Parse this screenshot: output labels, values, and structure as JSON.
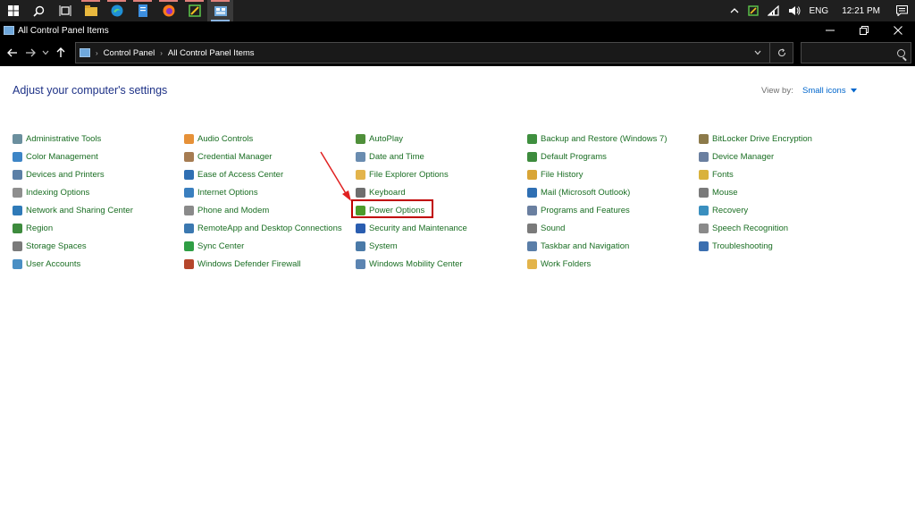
{
  "taskbar": {
    "tray": {
      "language": "ENG",
      "time": "12:21 PM"
    }
  },
  "window": {
    "title": "All Control Panel Items"
  },
  "address": {
    "breadcrumbs": [
      "Control Panel",
      "All Control Panel Items"
    ],
    "search_placeholder": ""
  },
  "page": {
    "heading": "Adjust your computer's settings",
    "view_by_label": "View by:",
    "view_by_value": "Small icons"
  },
  "items": [
    [
      {
        "label": "Administrative Tools",
        "icon": "admin-tools-icon",
        "color": "#6b8f9e"
      },
      {
        "label": "Color Management",
        "icon": "color-management-icon",
        "color": "#3d85c6"
      },
      {
        "label": "Devices and Printers",
        "icon": "printer-icon",
        "color": "#5b7fa6"
      },
      {
        "label": "Indexing Options",
        "icon": "indexing-icon",
        "color": "#8e8e8e"
      },
      {
        "label": "Network and Sharing Center",
        "icon": "network-icon",
        "color": "#2f7ab8"
      },
      {
        "label": "Region",
        "icon": "region-icon",
        "color": "#3d8b3d"
      },
      {
        "label": "Storage Spaces",
        "icon": "storage-icon",
        "color": "#7a7a7a"
      },
      {
        "label": "User Accounts",
        "icon": "user-accounts-icon",
        "color": "#4a8fc4"
      }
    ],
    [
      {
        "label": "Audio Controls",
        "icon": "audio-controls-icon",
        "color": "#e69138"
      },
      {
        "label": "Credential Manager",
        "icon": "credential-icon",
        "color": "#a67c52"
      },
      {
        "label": "Ease of Access Center",
        "icon": "ease-of-access-icon",
        "color": "#2f6fb3"
      },
      {
        "label": "Internet Options",
        "icon": "internet-icon",
        "color": "#3a7fbf"
      },
      {
        "label": "Phone and Modem",
        "icon": "phone-icon",
        "color": "#8a8a8a"
      },
      {
        "label": "RemoteApp and Desktop Connections",
        "icon": "remoteapp-icon",
        "color": "#3b78b0"
      },
      {
        "label": "Sync Center",
        "icon": "sync-icon",
        "color": "#2f9e44"
      },
      {
        "label": "Windows Defender Firewall",
        "icon": "firewall-icon",
        "color": "#b5462b"
      }
    ],
    [
      {
        "label": "AutoPlay",
        "icon": "autoplay-icon",
        "color": "#4f8f3a"
      },
      {
        "label": "Date and Time",
        "icon": "clock-icon",
        "color": "#6a8cb0"
      },
      {
        "label": "File Explorer Options",
        "icon": "folder-options-icon",
        "color": "#e3b44b"
      },
      {
        "label": "Keyboard",
        "icon": "keyboard-icon",
        "color": "#6e6e6e"
      },
      {
        "label": "Power Options",
        "icon": "power-icon",
        "color": "#4c9a2a"
      },
      {
        "label": "Security and Maintenance",
        "icon": "flag-icon",
        "color": "#2a5db0"
      },
      {
        "label": "System",
        "icon": "system-icon",
        "color": "#4a7aa8"
      },
      {
        "label": "Windows Mobility Center",
        "icon": "mobility-icon",
        "color": "#5b84b1"
      }
    ],
    [
      {
        "label": "Backup and Restore (Windows 7)",
        "icon": "backup-icon",
        "color": "#3f8f3f"
      },
      {
        "label": "Default Programs",
        "icon": "default-programs-icon",
        "color": "#3d8b3d"
      },
      {
        "label": "File History",
        "icon": "file-history-icon",
        "color": "#d9a536"
      },
      {
        "label": "Mail (Microsoft Outlook)",
        "icon": "mail-icon",
        "color": "#2f6fb3"
      },
      {
        "label": "Programs and Features",
        "icon": "programs-icon",
        "color": "#6a7fa0"
      },
      {
        "label": "Sound",
        "icon": "sound-icon",
        "color": "#7a7a7a"
      },
      {
        "label": "Taskbar and Navigation",
        "icon": "taskbar-icon",
        "color": "#5a7ea8"
      },
      {
        "label": "Work Folders",
        "icon": "work-folders-icon",
        "color": "#e3b44b"
      }
    ],
    [
      {
        "label": "BitLocker Drive Encryption",
        "icon": "bitlocker-icon",
        "color": "#8c7a4a"
      },
      {
        "label": "Device Manager",
        "icon": "device-manager-icon",
        "color": "#6a7fa0"
      },
      {
        "label": "Fonts",
        "icon": "fonts-icon",
        "color": "#d9b23c"
      },
      {
        "label": "Mouse",
        "icon": "mouse-icon",
        "color": "#7a7a7a"
      },
      {
        "label": "Recovery",
        "icon": "recovery-icon",
        "color": "#3a8fbf"
      },
      {
        "label": "Speech Recognition",
        "icon": "speech-icon",
        "color": "#8a8a8a"
      },
      {
        "label": "Troubleshooting",
        "icon": "troubleshooting-icon",
        "color": "#3b6fb0"
      }
    ]
  ]
}
